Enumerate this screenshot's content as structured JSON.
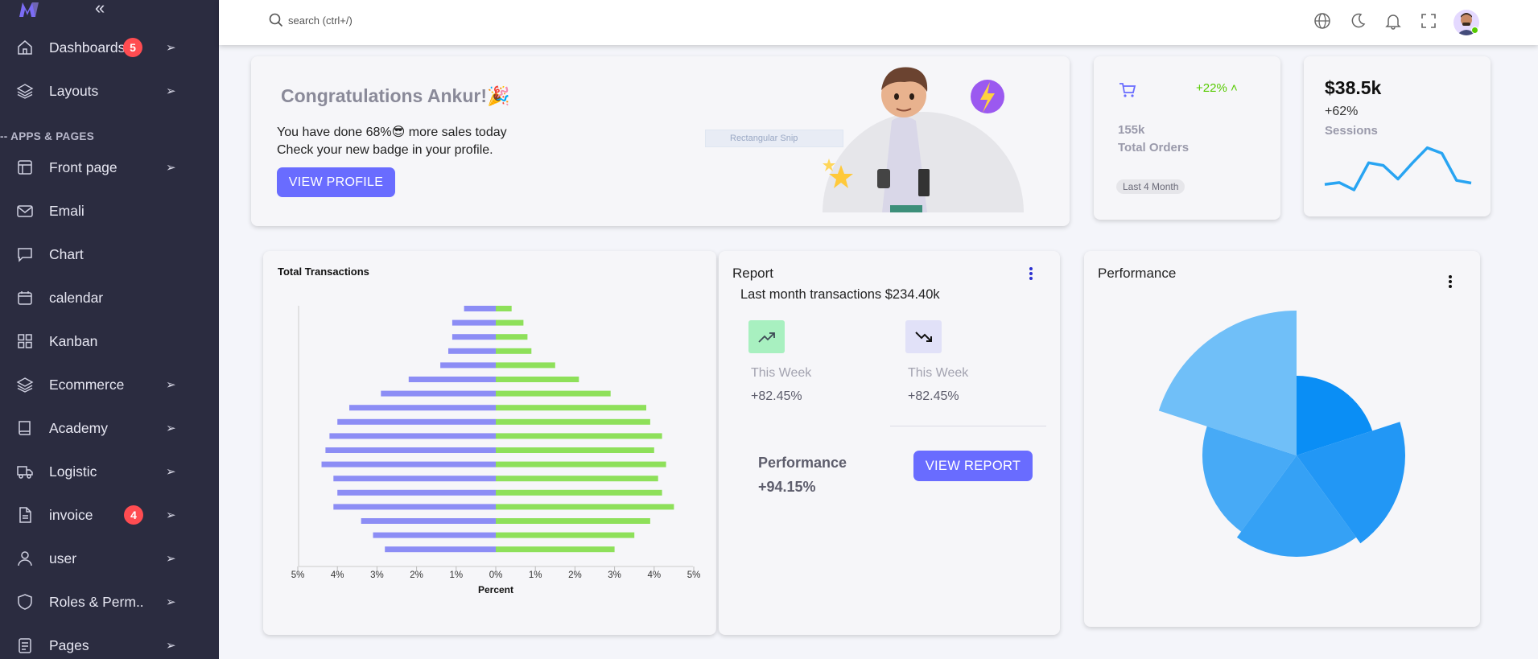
{
  "sidebar": {
    "collapse_icon": "double-chevron-left-icon",
    "section_title": "-- APPS & PAGES",
    "items": [
      {
        "label": "Dashboards",
        "icon": "home-icon",
        "badge": "5",
        "arrow": "➢"
      },
      {
        "label": "Layouts",
        "icon": "layers-icon",
        "arrow": "➢"
      },
      {
        "label": "Front page",
        "icon": "layout-icon",
        "arrow": "➢"
      },
      {
        "label": "Emali",
        "icon": "mail-icon"
      },
      {
        "label": "Chart",
        "icon": "chat-icon"
      },
      {
        "label": "calendar",
        "icon": "calendar-icon"
      },
      {
        "label": "Kanban",
        "icon": "grid-icon"
      },
      {
        "label": "Ecommerce",
        "icon": "layers-icon",
        "arrow": "➢"
      },
      {
        "label": "Academy",
        "icon": "book-icon",
        "arrow": "➢"
      },
      {
        "label": "Logistic",
        "icon": "truck-icon",
        "arrow": "➢"
      },
      {
        "label": "invoice",
        "icon": "file-icon",
        "badge": "4",
        "arrow": "➢"
      },
      {
        "label": "user",
        "icon": "user-icon",
        "arrow": "➢"
      },
      {
        "label": "Roles & Perm..",
        "icon": "shield-icon",
        "arrow": "➢"
      },
      {
        "label": "Pages",
        "icon": "page-icon",
        "arrow": "➢"
      }
    ]
  },
  "topbar": {
    "search_placeholder": "search (ctrl+/)",
    "icons": [
      "globe-icon",
      "moon-icon",
      "bell-icon",
      "fullscreen-icon"
    ]
  },
  "congrats": {
    "title": "Congratulations Ankur!🎉",
    "line1": "You have done 68%😎 more sales today",
    "line2": "Check your new badge in your profile.",
    "button": "VIEW PROFILE",
    "snip_text": "Rectangular Snip"
  },
  "orders": {
    "change": "+22%",
    "value": "155k",
    "label": "Total Orders",
    "pill": "Last 4 Month"
  },
  "sessions": {
    "value": "$38.5k",
    "change": "+62%",
    "label": "Sessions",
    "sparkline": [
      0.5,
      1.2,
      -1.5,
      8.5,
      7.5,
      2.5,
      8.5,
      14,
      12,
      2,
      1
    ]
  },
  "report": {
    "title": "Report",
    "subtitle": "Last month transactions $234.40k",
    "week1_label": "This Week",
    "week1_value": "+82.45%",
    "week2_label": "This Week",
    "week2_value": "+82.45%",
    "perf_label": "Performance",
    "perf_value": "+94.15%",
    "button": "VIEW REPORT",
    "colors": {
      "up": "#56ca00",
      "up_bg": "#a8f0c0",
      "down_bg": "#e1e1f8"
    }
  },
  "transactions": {
    "title": "Total Transactions",
    "chart_data": {
      "type": "bar",
      "orientation": "horizontal",
      "xlabel": "Percent",
      "xlim": [
        -5,
        5
      ],
      "ticks": [
        "5%",
        "4%",
        "3%",
        "2%",
        "1%",
        "0%",
        "1%",
        "2%",
        "3%",
        "4%",
        "5%"
      ],
      "series": [
        {
          "color": "#8c8df5",
          "values": [
            -0.8,
            -1.1,
            -1.1,
            -1.2,
            -1.4,
            -2.2,
            -2.9,
            -3.7,
            -4.0,
            -4.2,
            -4.3,
            -4.4,
            -4.1,
            -4.0,
            -4.1,
            -3.4,
            -3.1,
            -2.8
          ]
        },
        {
          "color": "#8ee05a",
          "values": [
            0.4,
            0.7,
            0.8,
            0.9,
            1.5,
            2.1,
            2.9,
            3.8,
            3.9,
            4.2,
            4.0,
            4.3,
            4.1,
            4.2,
            4.5,
            3.9,
            3.5,
            3.0
          ]
        }
      ]
    }
  },
  "performance": {
    "title": "Performance",
    "chart_data": {
      "type": "polar-area",
      "values": [
        0.66,
        0.9,
        0.84,
        0.78,
        1.2
      ],
      "colors": [
        "#0a8ef5",
        "#2297f5",
        "#35a1f5",
        "#47aaf6",
        "#70bff8"
      ]
    }
  },
  "colors": {
    "accent": "#696cff",
    "sidebar": "#2b2c40",
    "badge": "#ff4c51"
  }
}
